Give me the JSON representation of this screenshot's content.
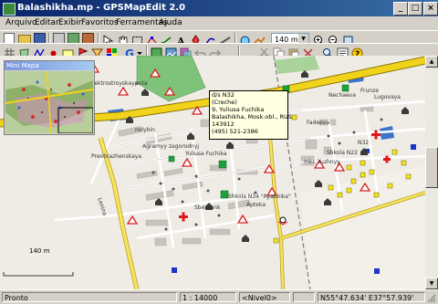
{
  "window": {
    "title": "Balashikha.mp - GPSMapEdit 2.0",
    "min": "_",
    "max": "□",
    "close": "×"
  },
  "menu": [
    "Arquivo",
    "Editar",
    "Exibir",
    "Favoritos",
    "Ferramentas",
    "Ajuda"
  ],
  "toolbar": {
    "zoom_value": "140 m"
  },
  "minimap": {
    "title": "Mini Mapa"
  },
  "map": {
    "scale_label": "140 m",
    "labels": [
      "elektrostroyskaya",
      "pota",
      "Agramyy zagorodnyj",
      "Preobrazhenskaya",
      "nolybin",
      "Yuliusa Fuchika",
      "N32",
      "mkr. Yuzhnyy",
      "Shkola N22",
      "Shkola N34 \"Ryabinka\"",
      "Sberbank",
      "Fadeeva",
      "Nechaeva",
      "Frunze",
      "Lugovaya",
      "Lenina",
      "Apteka"
    ]
  },
  "tooltip": {
    "lines": [
      "d/s N32",
      "(Creche)",
      "9, Yuliusa Fuchika",
      "Balashikha, Mosk.obl., RUS",
      "143912",
      "(495) 521-2386"
    ]
  },
  "status": {
    "ready": "Pronto",
    "scale": "1 : 14000",
    "level": "<Nivel0>",
    "coords": "N55°47.634' E37°57.939'"
  }
}
